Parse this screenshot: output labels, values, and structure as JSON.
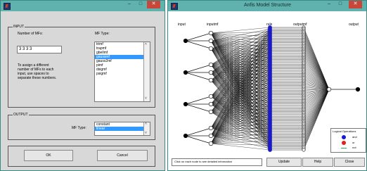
{
  "left_window": {
    "input_panel_label": "INPUT",
    "num_mfs_label": "Number of MFs:",
    "num_mfs_value": "3 3 3 3",
    "hint": [
      "To assign a different",
      "number of MFs to each",
      "input, use spaces to",
      "separate these numbers."
    ],
    "mf_type_label": "MF Type:",
    "mf_types": [
      "trimf",
      "trapmf",
      "gbellmf",
      "gaussmf",
      "gauss2mf",
      "pimf",
      "dsigmf",
      "psigmf"
    ],
    "mf_type_selected": "gaussmf",
    "output_panel_label": "OUTPUT",
    "out_mf_type_label": "MF Type:",
    "out_mf_types": [
      "constant",
      "linear"
    ],
    "out_mf_selected": "linear",
    "ok_label": "OK",
    "cancel_label": "Cancel",
    "minimize": "–",
    "maximize": "□",
    "close": "✕"
  },
  "right_window": {
    "title": "Anfis Model Structure",
    "minimize": "–",
    "maximize": "□",
    "close": "✕",
    "layer_labels": {
      "input": "input",
      "inputmf": "inputmf",
      "rule": "rule",
      "outputmf": "outputmf",
      "output": "output"
    },
    "legend_title": "Logical Operations",
    "legend_items": [
      {
        "label": "and",
        "color": "#1a1acc"
      },
      {
        "label": "or",
        "color": "#dd2222"
      },
      {
        "label": "not",
        "color": "#22aa44"
      }
    ],
    "status_text": "Click on each node to see detailed information",
    "update_label": "Update",
    "help_label": "Help",
    "close_label": "Close"
  }
}
